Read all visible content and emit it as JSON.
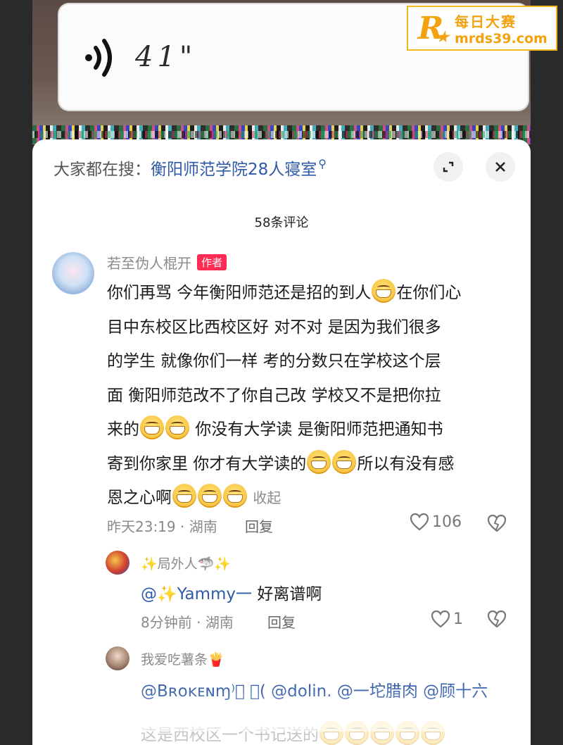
{
  "voice_message": {
    "duration": "41\""
  },
  "watermark": {
    "logo": "R",
    "name": "每日大赛",
    "url": "mrds39.com"
  },
  "search_bar": {
    "prefix": "大家都在搜：",
    "term": "衡阳师范学院28人寝室",
    "search_icon": "search-icon"
  },
  "panel": {
    "comment_count": "58条评论",
    "expand_icon": "expand-icon",
    "close_icon": "close-icon"
  },
  "comment": {
    "user": "若至伪人棍开",
    "author_tag": "作者",
    "lines": [
      "你们再骂  今年衡阳师范还是招的到人",
      "在你们心",
      "目中东校区比西校区好  对不对   是因为我们很多",
      "的学生  就像你们一样  考的分数只在学校这个层",
      "面  衡阳师范改不了你自己改  学校又不是把你拉",
      "来的",
      "  你没有大学读  是衡阳师范把通知书",
      "寄到你家里 你才有大学读的",
      "所以有没有感",
      "恩之心啊",
      "收起"
    ],
    "time": "昨天23:19",
    "location": "湖南",
    "reply_label": "回复",
    "likes": "106"
  },
  "replies": [
    {
      "user": "✨局外人🦈✨",
      "mention": "@✨Yammy一",
      "text": " 好离谱啊",
      "time": "8分钟前",
      "location": "湖南",
      "reply_label": "回复",
      "likes": "1"
    },
    {
      "user": "我爱吃薯条🍟",
      "mentions": "@Bʀᴏᴋᴇɴɱ⁾⃝ ⃝( @dolin. @一坨腊肉 @顾十六",
      "partial_text": "这是西校区一个书记送的"
    }
  ],
  "colors": {
    "accent": "#fe2c55",
    "mention": "#2f5aa8",
    "watermark": "#f2a30f"
  }
}
